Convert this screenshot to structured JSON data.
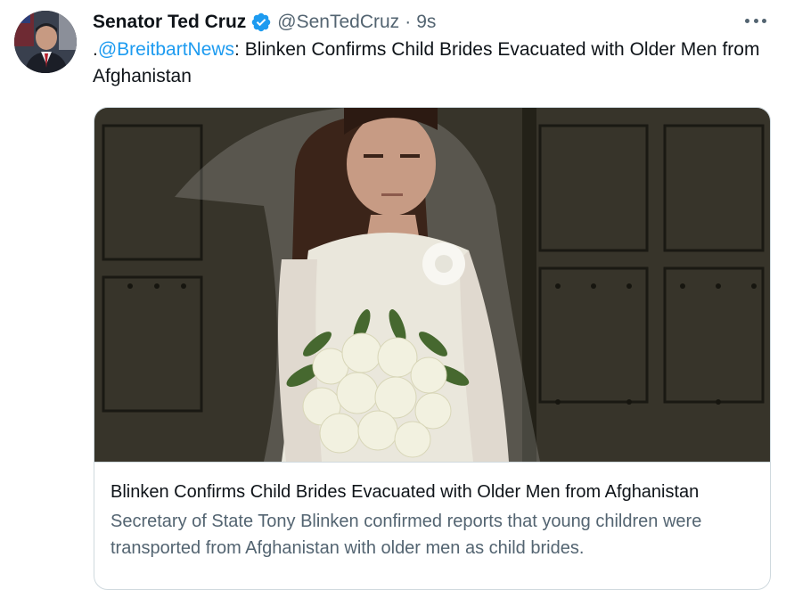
{
  "author": {
    "name": "Senator Ted Cruz",
    "handle": "@SenTedCruz",
    "separator": "·",
    "time": "9s"
  },
  "tweet": {
    "prefix": ".",
    "mention": "@BreitbartNews",
    "text": ": Blinken Confirms Child Brides Evacuated with Older Men from Afghanistan"
  },
  "card": {
    "title": "Blinken Confirms Child Brides Evacuated with Older Men from Afghanistan",
    "description": "Secretary of State Tony Blinken confirmed reports that young children were transported from Afghanistan with older men as child brides."
  },
  "icons": {
    "verified": "verified-badge-icon",
    "more": "more-options-icon"
  },
  "colors": {
    "accent": "#1d9bf0",
    "secondary_text": "#536471",
    "border": "#cfd9de"
  }
}
